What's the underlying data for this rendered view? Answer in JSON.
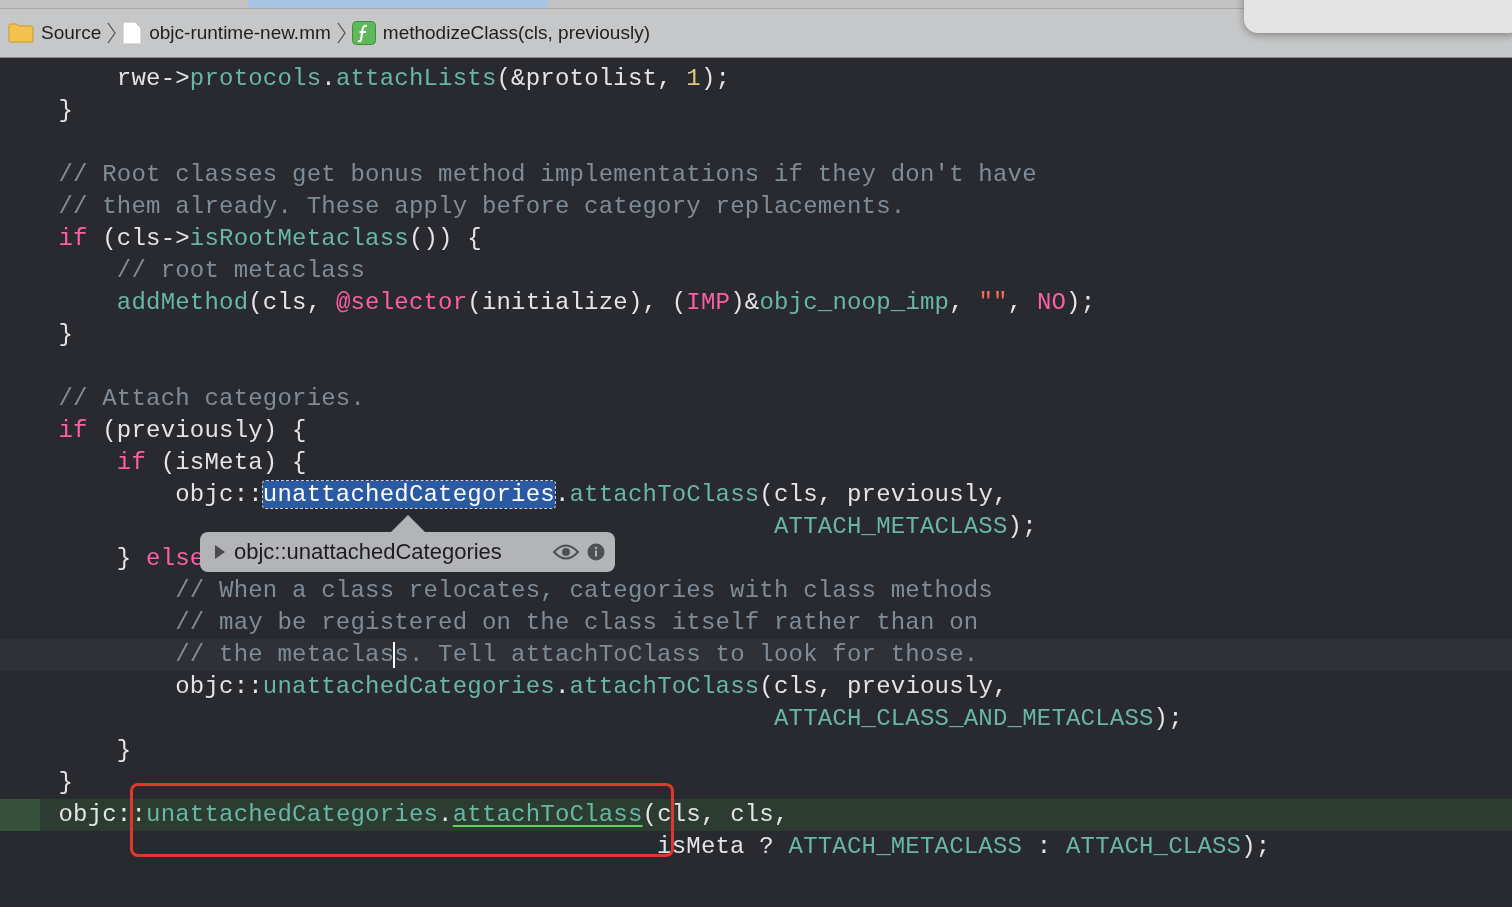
{
  "breadcrumb": [
    {
      "kind": "folder",
      "label": "Source"
    },
    {
      "kind": "file",
      "label": "objc-runtime-new.mm"
    },
    {
      "kind": "function",
      "label": "methodizeClass(cls, previously)"
    }
  ],
  "code": {
    "lines": [
      {
        "tokens": [
          {
            "kind": "plain",
            "text": "        rwe->"
          },
          {
            "kind": "func",
            "text": "protocols"
          },
          {
            "kind": "plain",
            "text": "."
          },
          {
            "kind": "func",
            "text": "attachLists"
          },
          {
            "kind": "plain",
            "text": "(&protolist, "
          },
          {
            "kind": "number",
            "text": "1"
          },
          {
            "kind": "plain",
            "text": ");"
          }
        ]
      },
      {
        "tokens": [
          {
            "kind": "plain",
            "text": "    }"
          }
        ]
      },
      {
        "blank_line_before": true,
        "tokens": [
          {
            "kind": "comment",
            "text": "    // Root classes get bonus method implementations if they don't have"
          }
        ]
      },
      {
        "tokens": [
          {
            "kind": "comment",
            "text": "    // them already. These apply before category replacements."
          }
        ]
      },
      {
        "tokens": [
          {
            "kind": "keyword",
            "text": "    if"
          },
          {
            "kind": "plain",
            "text": " (cls->"
          },
          {
            "kind": "func",
            "text": "isRootMetaclass"
          },
          {
            "kind": "plain",
            "text": "()) {"
          }
        ]
      },
      {
        "tokens": [
          {
            "kind": "comment",
            "text": "        // root metaclass"
          }
        ]
      },
      {
        "tokens": [
          {
            "kind": "func",
            "text": "        addMethod"
          },
          {
            "kind": "plain",
            "text": "(cls, "
          },
          {
            "kind": "keyword",
            "text": "@selector"
          },
          {
            "kind": "plain",
            "text": "(initialize), ("
          },
          {
            "kind": "keyword",
            "text": "IMP"
          },
          {
            "kind": "plain",
            "text": ")&"
          },
          {
            "kind": "func",
            "text": "objc_noop_imp"
          },
          {
            "kind": "plain",
            "text": ", "
          },
          {
            "kind": "string",
            "text": "\"\""
          },
          {
            "kind": "plain",
            "text": ", "
          },
          {
            "kind": "keyword",
            "text": "NO"
          },
          {
            "kind": "plain",
            "text": ");"
          }
        ]
      },
      {
        "tokens": [
          {
            "kind": "plain",
            "text": "    }"
          }
        ]
      },
      {
        "blank_line_before": true,
        "tokens": [
          {
            "kind": "comment",
            "text": "    // Attach categories."
          }
        ]
      },
      {
        "tokens": [
          {
            "kind": "keyword",
            "text": "    if"
          },
          {
            "kind": "plain",
            "text": " (previously) {"
          }
        ]
      },
      {
        "tokens": [
          {
            "kind": "keyword",
            "text": "        if"
          },
          {
            "kind": "plain",
            "text": " (isMeta) {"
          }
        ]
      },
      {
        "tokens": [
          {
            "kind": "plain",
            "text": "            objc::"
          },
          {
            "kind": "selected",
            "text": "unattachedCategories"
          },
          {
            "kind": "plain",
            "text": "."
          },
          {
            "kind": "func",
            "text": "attachToClass"
          },
          {
            "kind": "plain",
            "text": "(cls, previously,"
          }
        ]
      },
      {
        "tokens": [
          {
            "kind": "func",
            "text": "                                                     ATTACH_METACLASS"
          },
          {
            "kind": "plain",
            "text": ");"
          }
        ]
      },
      {
        "tokens": [
          {
            "kind": "plain",
            "text": "        } "
          },
          {
            "kind": "keyword",
            "text": "else"
          }
        ]
      },
      {
        "tokens": [
          {
            "kind": "comment",
            "text": "            // When a class relocates, categories with class methods"
          }
        ]
      },
      {
        "tokens": [
          {
            "kind": "comment",
            "text": "            // may be registered on the class itself rather than on"
          }
        ]
      },
      {
        "current_line": true,
        "tokens": [
          {
            "kind": "comment",
            "text": "            // the metaclas"
          },
          {
            "kind": "caret"
          },
          {
            "kind": "comment",
            "text": "s. Tell attachToClass to look for those."
          }
        ]
      },
      {
        "tokens": [
          {
            "kind": "plain",
            "text": "            objc::"
          },
          {
            "kind": "func",
            "text": "unattachedCategories"
          },
          {
            "kind": "plain",
            "text": "."
          },
          {
            "kind": "func",
            "text": "attachToClass"
          },
          {
            "kind": "plain",
            "text": "(cls, previously,"
          }
        ]
      },
      {
        "tokens": [
          {
            "kind": "func",
            "text": "                                                     ATTACH_CLASS_AND_METACLASS"
          },
          {
            "kind": "plain",
            "text": ");"
          }
        ]
      },
      {
        "tokens": [
          {
            "kind": "plain",
            "text": "        }"
          }
        ]
      },
      {
        "tokens": [
          {
            "kind": "plain",
            "text": "    }"
          }
        ]
      },
      {
        "execution_point": true,
        "tokens": [
          {
            "kind": "plain",
            "text": "    objc::"
          },
          {
            "kind": "func",
            "text": "unattachedCategories"
          },
          {
            "kind": "plain",
            "text": "."
          },
          {
            "kind": "link",
            "text": "attachToClass"
          },
          {
            "kind": "plain",
            "text": "(cls, cls,"
          }
        ]
      },
      {
        "tokens": [
          {
            "kind": "plain",
            "text": "                                             isMeta ? "
          },
          {
            "kind": "func",
            "text": "ATTACH_METACLASS"
          },
          {
            "kind": "plain",
            "text": " : "
          },
          {
            "kind": "func",
            "text": "ATTACH_CLASS"
          },
          {
            "kind": "plain",
            "text": ");"
          }
        ]
      }
    ]
  },
  "tooltip": {
    "text": "objc::unattachedCategories",
    "expanded": false
  },
  "annotation": {
    "color": "#e0382c"
  }
}
